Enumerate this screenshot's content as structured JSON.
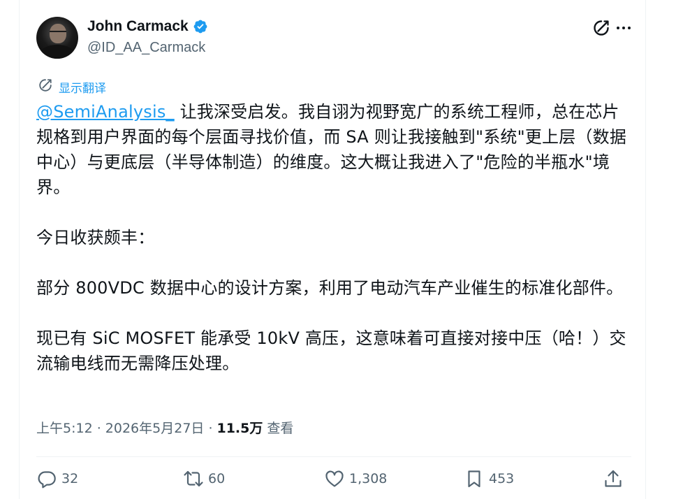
{
  "author": {
    "display_name": "John Carmack",
    "handle": "@ID_AA_Carmack"
  },
  "translate_label": "显示翻译",
  "tweet": {
    "mention": "@SemiAnalysis_",
    "para1_rest": " 让我深受启发。我自诩为视野宽广的系统工程师，总在芯片规格到用户界面的每个层面寻找价值，而 SA 则让我接触到\"系统\"更上层（数据中心）与更底层（半导体制造）的维度。这大概让我进入了\"危险的半瓶水\"境界。",
    "para2": "今日收获颇丰：",
    "para3": "部分 800VDC 数据中心的设计方案，利用了电动汽车产业催生的标准化部件。",
    "para4": "现已有 SiC MOSFET 能承受 10kV 高压，这意味着可直接对接中压（哈！）交流输电线而无需降压处理。"
  },
  "meta": {
    "time_date": "上午5:12 · 2026年5月27日 ·",
    "views_count": "11.5万",
    "views_label": "查看"
  },
  "actions": {
    "replies": "32",
    "reposts": "60",
    "likes": "1,308",
    "bookmarks": "453"
  },
  "colors": {
    "accent": "#1d9bf0",
    "secondary_text": "#536471",
    "primary_text": "#0f1419"
  },
  "icons": {
    "verified": "verified-badge-icon",
    "grok": "grok-icon",
    "more": "more-icon",
    "translate": "translate-icon",
    "reply": "reply-icon",
    "repost": "repost-icon",
    "like": "like-icon",
    "bookmark": "bookmark-icon",
    "share": "share-icon"
  }
}
